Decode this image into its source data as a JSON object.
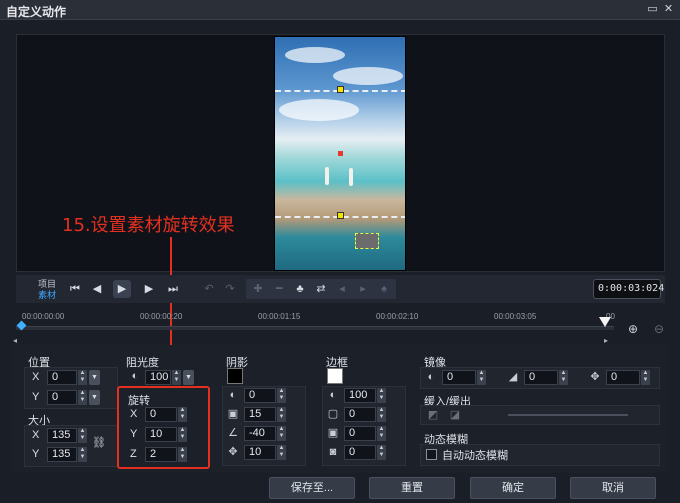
{
  "window": {
    "title": "自定义动作",
    "maximize_icon": "maximize-icon",
    "close_icon": "close-icon"
  },
  "transport": {
    "project_label": "项目",
    "clip_label": "素材",
    "timecode": "0:00:03:024"
  },
  "timeline": {
    "ticks": [
      "00:00:00:00",
      "00:00:00:20",
      "00:00:01:15",
      "00:00:02:10",
      "00:00:03:05",
      "00"
    ]
  },
  "annotation": {
    "text": "15.设置素材旋转效果",
    "color": "#e33020"
  },
  "properties": {
    "position": {
      "label": "位置",
      "x_label": "X",
      "x": "0",
      "y_label": "Y",
      "y": "0"
    },
    "size": {
      "label": "大小",
      "x_label": "X",
      "x": "135",
      "y_label": "Y",
      "y": "135"
    },
    "opacity": {
      "label": "阻光度",
      "value": "100"
    },
    "rotation": {
      "label": "旋转",
      "x_label": "X",
      "x": "0",
      "y_label": "Y",
      "y": "10",
      "z_label": "Z",
      "z": "2"
    },
    "shadow": {
      "label": "阴影",
      "color": "#000000",
      "opacity": "0",
      "blur": "15",
      "angle": "-40",
      "distance": "10"
    },
    "border": {
      "label": "边框",
      "color": "#ffffff",
      "opacity": "100",
      "width": "0",
      "blur": "0",
      "shadow": "0"
    },
    "mirror": {
      "label": "镜像",
      "opacity": "0",
      "value2": "0",
      "value3": "0"
    },
    "ease": {
      "label": "缓入/缓出"
    },
    "motion_blur": {
      "label": "动态模糊",
      "auto_label": "自动动态模糊"
    }
  },
  "footer": {
    "save_to": "保存至...",
    "reset": "重置",
    "ok": "确定",
    "cancel": "取消"
  }
}
